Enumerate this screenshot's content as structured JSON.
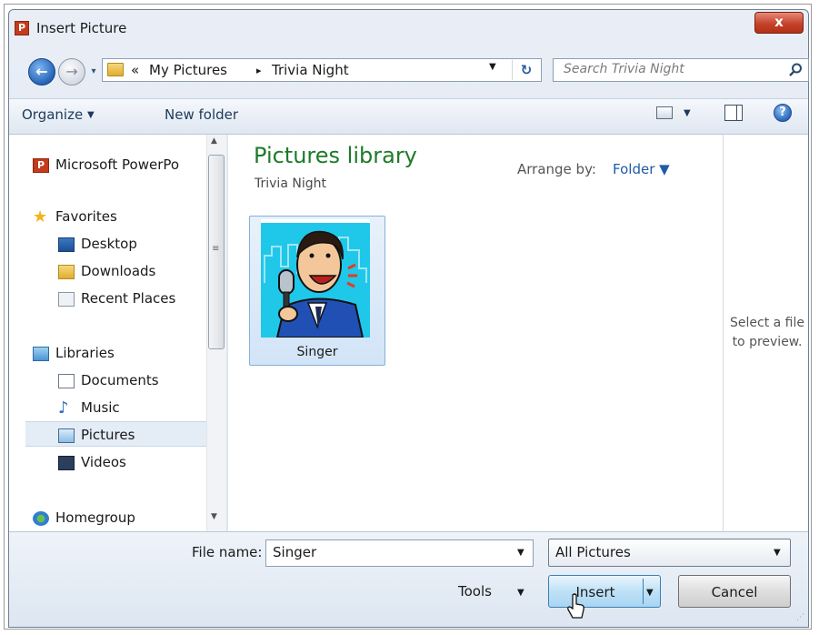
{
  "window": {
    "title": "Insert Picture",
    "close_label": "x"
  },
  "nav": {
    "back_glyph": "←",
    "forward_glyph": "→",
    "history_glyph": "▾",
    "breadcrumb_sep_overflow": "«",
    "breadcrumb": [
      "My Pictures",
      "Trivia Night"
    ],
    "breadcrumb_arrow": "▸",
    "address_drop": "▼",
    "refresh_glyph": "↻",
    "search_placeholder": "Search Trivia Night"
  },
  "toolbar": {
    "organize": "Organize",
    "organize_drop": "▼",
    "new_folder": "New folder",
    "view_drop": "▼",
    "help_glyph": "?"
  },
  "sidebar": {
    "items": [
      {
        "label": "Microsoft PowerPo",
        "icon": "powerpoint-icon"
      },
      {
        "label": "Favorites",
        "icon": "star-icon"
      },
      {
        "label": "Desktop",
        "icon": "desktop-icon"
      },
      {
        "label": "Downloads",
        "icon": "downloads-icon"
      },
      {
        "label": "Recent Places",
        "icon": "recent-places-icon"
      },
      {
        "label": "Libraries",
        "icon": "libraries-icon"
      },
      {
        "label": "Documents",
        "icon": "documents-icon"
      },
      {
        "label": "Music",
        "icon": "music-icon"
      },
      {
        "label": "Pictures",
        "icon": "pictures-icon",
        "selected": true
      },
      {
        "label": "Videos",
        "icon": "videos-icon"
      },
      {
        "label": "Homegroup",
        "icon": "homegroup-icon"
      }
    ],
    "scroll_up": "▲",
    "scroll_down": "▼",
    "scroll_grip": "≡"
  },
  "main": {
    "library_title": "Pictures library",
    "library_subtitle": "Trivia Night",
    "arrange_label": "Arrange by:",
    "arrange_value": "Folder ▼",
    "files": [
      {
        "name": "Singer",
        "selected": true
      }
    ]
  },
  "preview": {
    "text_line1": "Select a file",
    "text_line2": "to preview."
  },
  "footer": {
    "file_name_label": "File name:",
    "file_name_value": "Singer",
    "file_name_drop": "▼",
    "file_type_value": "All Pictures",
    "file_type_drop": "▼",
    "tools_label": "Tools",
    "tools_drop": "▼",
    "insert_label": "Insert",
    "insert_drop": "▼",
    "cancel_label": "Cancel",
    "resize_grip": "⋰"
  },
  "colors": {
    "accent": "#1f5ba6",
    "library_title": "#1e7a28",
    "close_button": "#c6422b",
    "selection": "#d2e4f7"
  }
}
